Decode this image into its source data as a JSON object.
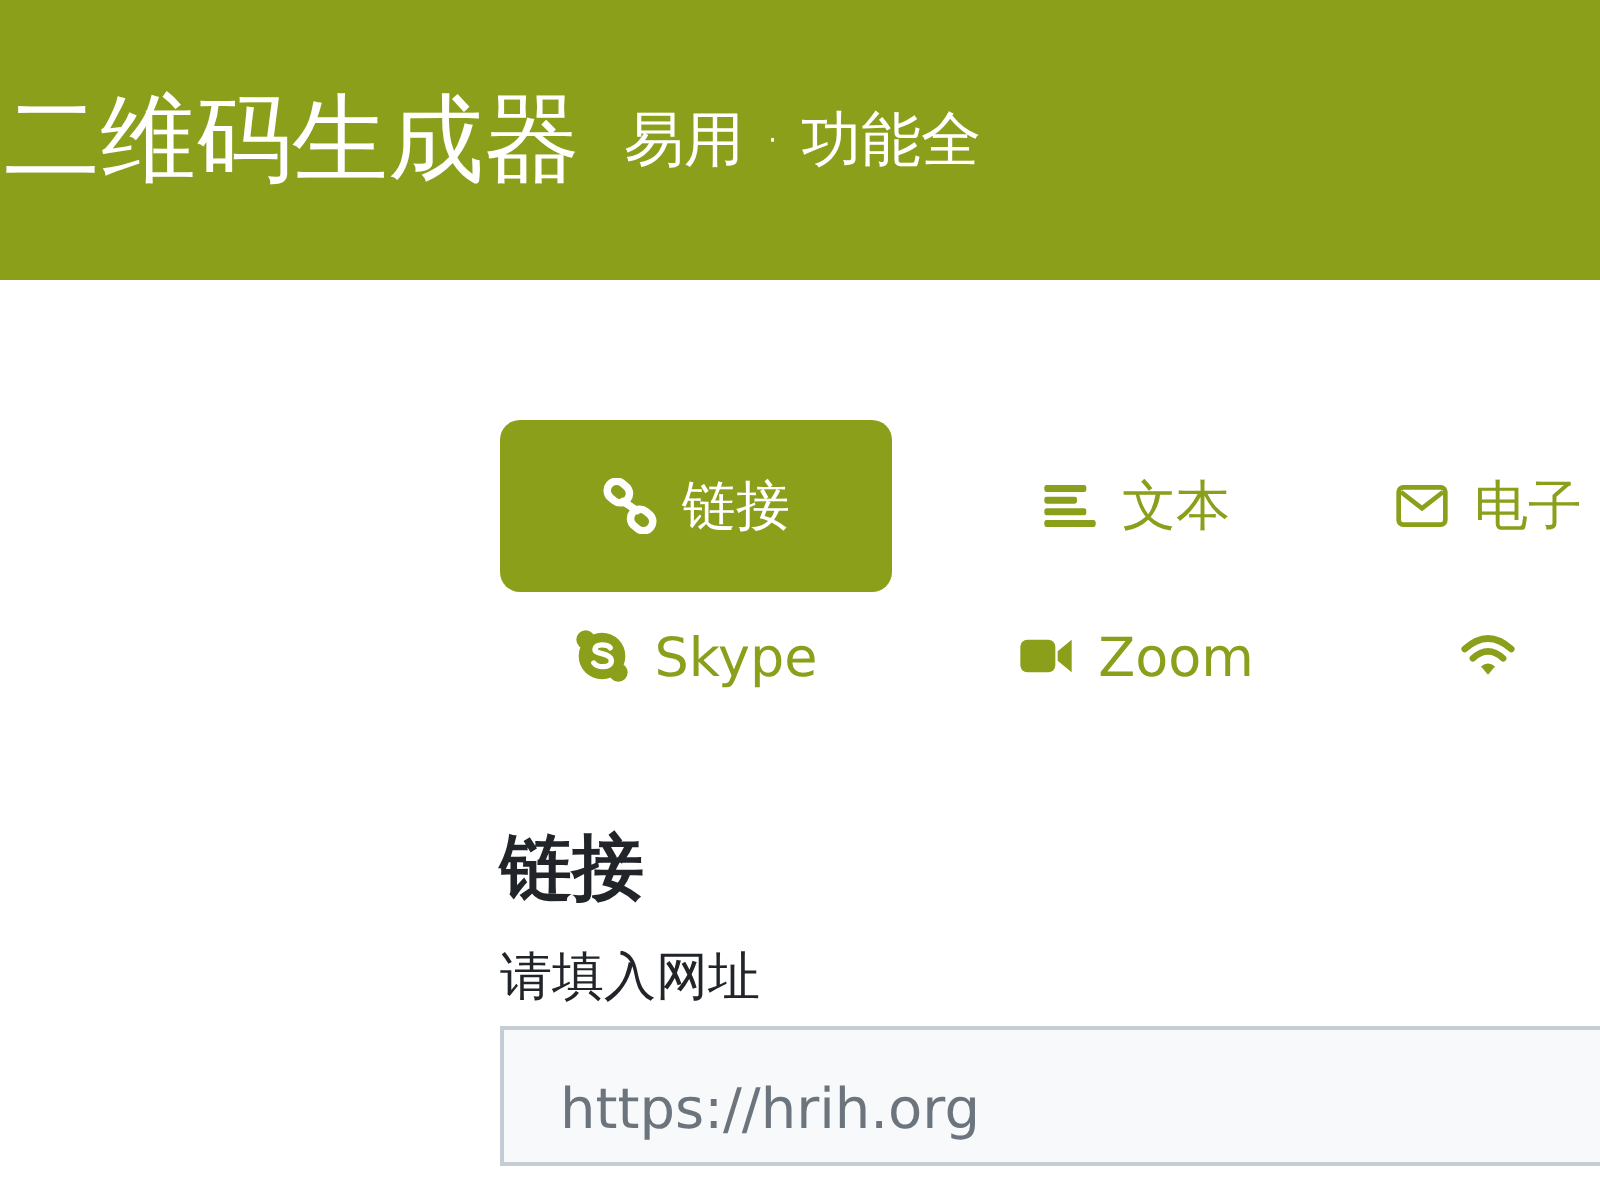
{
  "header": {
    "title": "二维码生成器",
    "subtitle": "易用 · 功能全"
  },
  "tabs": [
    {
      "label": "链接",
      "kind": "link",
      "selected": true
    },
    {
      "label": "文本",
      "kind": "text",
      "selected": false
    },
    {
      "label": "电子",
      "kind": "email",
      "selected": false
    },
    {
      "label": "Skype",
      "kind": "skype",
      "selected": false
    },
    {
      "label": "Zoom",
      "kind": "zoom",
      "selected": false
    },
    {
      "kind": "wifi",
      "selected": false
    }
  ],
  "section": {
    "heading": "链接",
    "field_label": "请填入网址",
    "placeholder": "https://hrih.org"
  }
}
